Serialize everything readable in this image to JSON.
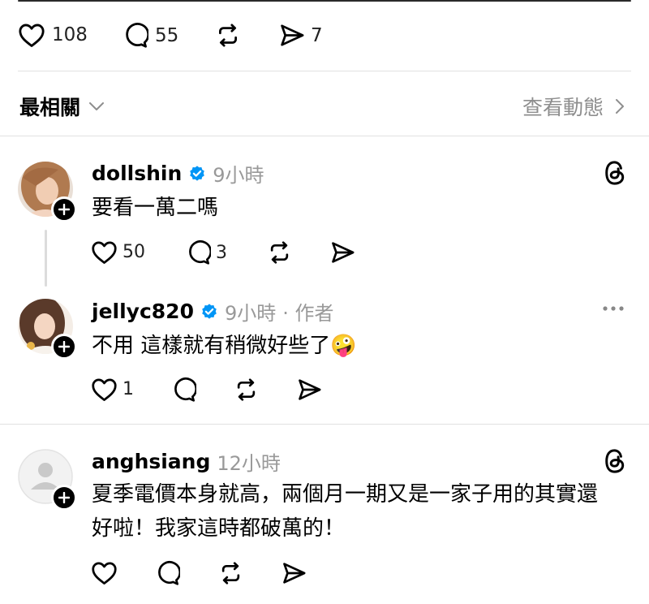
{
  "post_actions": {
    "likes": "108",
    "replies": "55",
    "sends": "7"
  },
  "sort": {
    "label": "最相關",
    "activity_link": "查看動態"
  },
  "comments": [
    {
      "username": "dollshin",
      "time": "9小時",
      "text": "要看一萬二嗎",
      "likes": "50",
      "replies": "3"
    },
    {
      "username": "jellyc820",
      "time": "9小時",
      "author_tag": "· 作者",
      "text": "不用 這樣就有稍微好些了🤪",
      "likes": "1"
    },
    {
      "username": "anghsiang",
      "time": "12小時",
      "text_line1": "夏季電價本身就高，兩個月一期又是一家子用的其實還",
      "text_line2": "好啦！我家這時都破萬的！"
    }
  ],
  "colors": {
    "verified": "#0095f6",
    "secondary_text": "#999999",
    "divider": "#e1e1e1"
  }
}
